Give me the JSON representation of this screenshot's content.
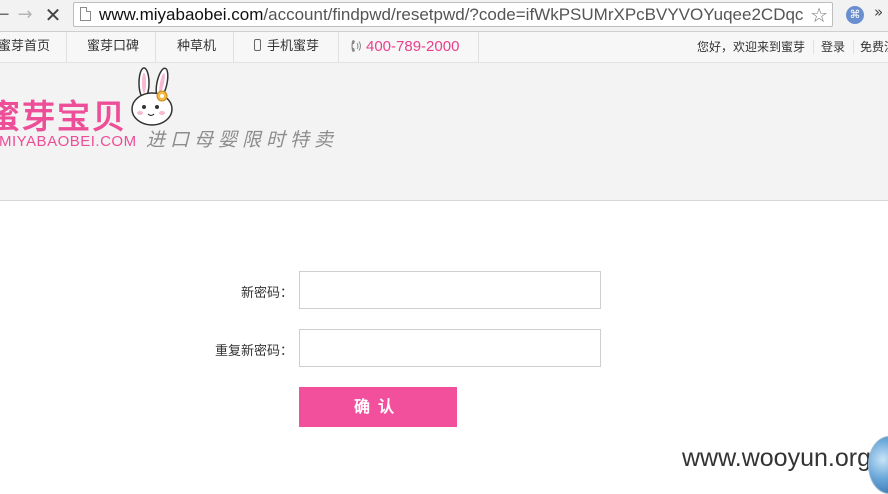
{
  "browser": {
    "url_host": "www.miyabaobei.com",
    "url_path": "/account/findpwd/resetpwd/?code=ifWkPSUMrXPcBVYVOYuqee2CDqc",
    "back_icon": "←",
    "forward_icon": "→",
    "stop_icon": "✕",
    "star_icon": "☆",
    "ext_icon": "⌘",
    "more_icon": "»"
  },
  "topbar": {
    "home": "蜜芽首页",
    "reputation": "蜜芽口碑",
    "seed_machine": "种草机",
    "mobile": "手机蜜芽",
    "hotline": "400-789-2000",
    "welcome": "您好，欢迎来到蜜芽",
    "login": "登录",
    "register": "免费注册"
  },
  "header": {
    "logo_text": "蜜芽宝贝",
    "logo_domain": "MIYABAOBEI.COM",
    "slogan": "进口母婴限时特卖"
  },
  "form": {
    "new_password_label": "新密码：",
    "new_password_value": "",
    "confirm_password_label": "重复新密码：",
    "confirm_password_value": "",
    "submit_label": "确认"
  },
  "watermark": {
    "text": "www.wooyun.org"
  },
  "colors": {
    "brand_pink": "#ee4d97",
    "button_pink": "#f2509d"
  }
}
